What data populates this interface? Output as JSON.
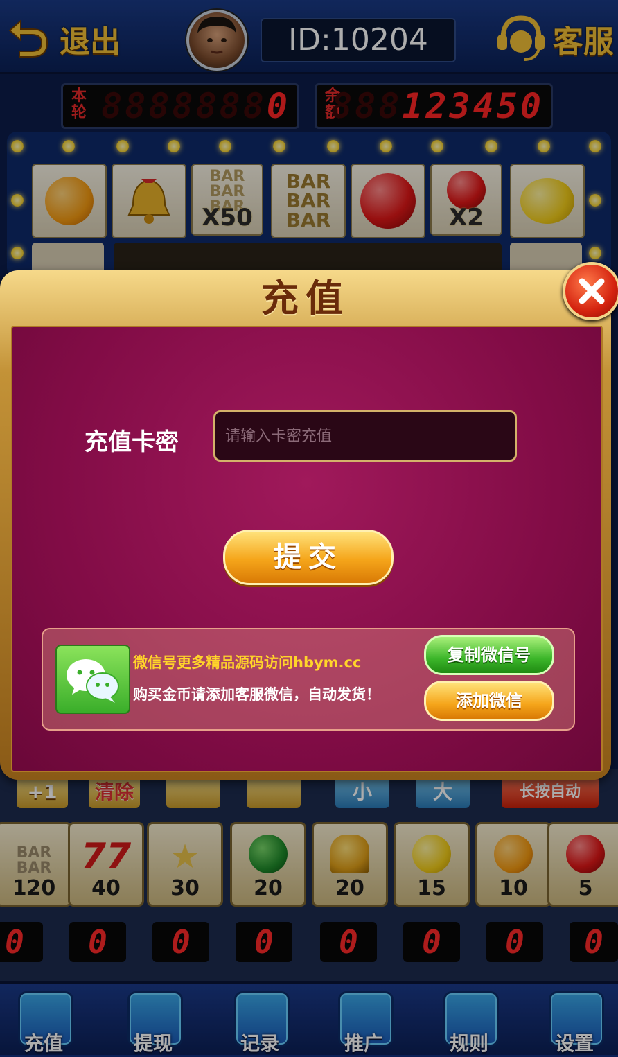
{
  "topbar": {
    "exit_label": "退出",
    "id_text": "ID:10204",
    "service_label": "客服"
  },
  "counters": {
    "round_tag": "本轮",
    "round_value": "0",
    "round_ghost": "8888888",
    "balance_tag": "余额",
    "balance_value": "123450",
    "balance_ghost": "888"
  },
  "board": {
    "row1": [
      {
        "icon": "orange-icon",
        "mult": ""
      },
      {
        "icon": "bell-icon",
        "mult": ""
      },
      {
        "icon": "bar-icon",
        "mult": "X50"
      },
      {
        "icon": "bar-icon",
        "mult": ""
      },
      {
        "icon": "apple-icon",
        "mult": ""
      },
      {
        "icon": "apple-icon",
        "mult": "X2"
      },
      {
        "icon": "lemon-icon",
        "mult": ""
      }
    ],
    "bar_text": "BAR"
  },
  "controls": {
    "plus_one": "+1",
    "clear": "清除",
    "small": "小",
    "big": "大",
    "auto": "长按自动"
  },
  "bets": [
    {
      "icon": "bar-icon",
      "value": "120"
    },
    {
      "icon": "seven-icon",
      "value": "40"
    },
    {
      "icon": "star-icon",
      "value": "30"
    },
    {
      "icon": "watermelon-icon",
      "value": "20"
    },
    {
      "icon": "bell-icon",
      "value": "20"
    },
    {
      "icon": "lemon-icon",
      "value": "15"
    },
    {
      "icon": "orange-icon",
      "value": "10"
    },
    {
      "icon": "apple-icon",
      "value": "5"
    }
  ],
  "led_value": "0",
  "nav": {
    "recharge": "充值",
    "withdraw": "提现",
    "records": "记录",
    "promote": "推广",
    "rules": "规则",
    "settings": "设置"
  },
  "dialog": {
    "title": "充值",
    "card_label": "充值卡密",
    "card_placeholder": "请输入卡密充值",
    "submit_label": "提交",
    "info_line1": "微信号更多精品源码访问hbym.cc",
    "info_line2": "购买金币请添加客服微信，自动发货！",
    "copy_label": "复制微信号",
    "add_label": "添加微信"
  },
  "colors": {
    "panel": "#820c46",
    "gold": "#f2c037",
    "led_red": "#ff2626"
  }
}
